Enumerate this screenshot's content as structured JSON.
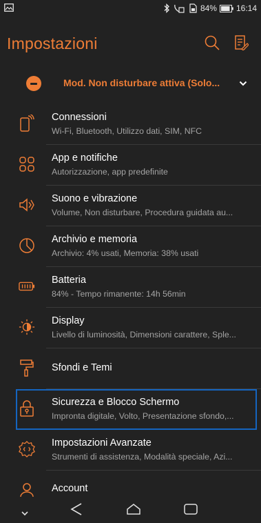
{
  "status_bar": {
    "battery_percent": "84%",
    "time": "16:14"
  },
  "header": {
    "title": "Impostazioni"
  },
  "dnd": {
    "label": "Mod. Non disturbare attiva (Solo..."
  },
  "items": [
    {
      "icon": "phone-signal-icon",
      "title": "Connessioni",
      "subtitle": "Wi-Fi, Bluetooth, Utilizzo dati, SIM, NFC"
    },
    {
      "icon": "apps-grid-icon",
      "title": "App e notifiche",
      "subtitle": "Autorizzazione, app predefinite"
    },
    {
      "icon": "speaker-icon",
      "title": "Suono e vibrazione",
      "subtitle": "Volume, Non disturbare, Procedura guidata au..."
    },
    {
      "icon": "storage-pie-icon",
      "title": "Archivio e memoria",
      "subtitle": "Archivio: 4% usati, Memoria: 38% usati"
    },
    {
      "icon": "battery-icon",
      "title": "Batteria",
      "subtitle": "84% - Tempo rimanente: 14h 56min"
    },
    {
      "icon": "brightness-icon",
      "title": "Display",
      "subtitle": "Livello di luminosità, Dimensioni carattere, Sple..."
    },
    {
      "icon": "paint-roller-icon",
      "title": "Sfondi e Temi",
      "subtitle": ""
    },
    {
      "icon": "lock-icon",
      "title": "Sicurezza e Blocco Schermo",
      "subtitle": "Impronta digitale, Volto, Presentazione sfondo,..."
    },
    {
      "icon": "advanced-gear-icon",
      "title": "Impostazioni Avanzate",
      "subtitle": "Strumenti di assistenza, Modalità speciale, Azi..."
    },
    {
      "icon": "account-icon",
      "title": "Account",
      "subtitle": ""
    }
  ],
  "colors": {
    "accent": "#ee7d36",
    "background": "#222222",
    "selection_border": "#1565c0"
  }
}
